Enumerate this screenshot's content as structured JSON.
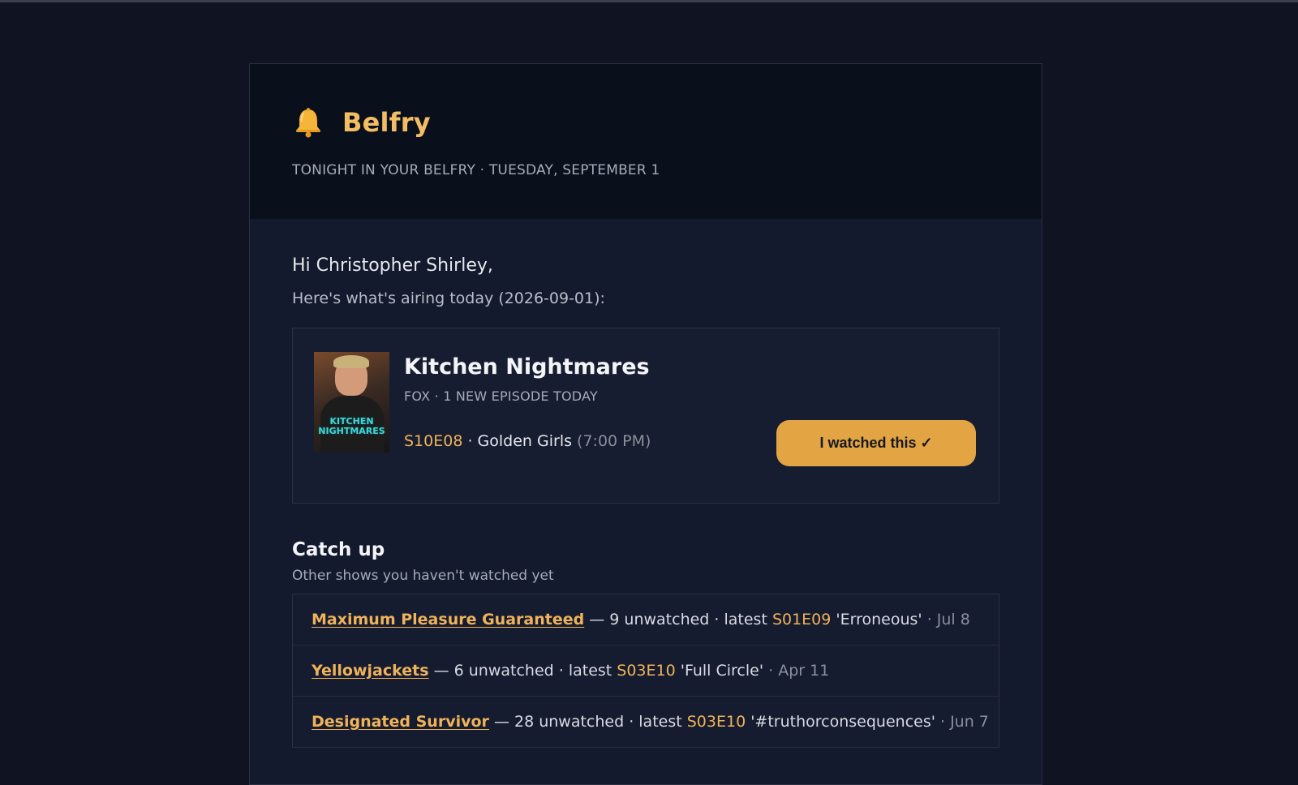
{
  "header": {
    "brand_name": "Belfry",
    "bell_icon": "bell-icon",
    "tagline": "TONIGHT IN YOUR BELFRY · TUESDAY, SEPTEMBER 1"
  },
  "intro": {
    "greeting": "Hi Christopher Shirley,",
    "airing_text": "Here's what's airing today (2026-09-01):"
  },
  "show": {
    "title": "Kitchen Nightmares",
    "meta": "FOX · 1 NEW EPISODE TODAY",
    "poster_text": "KITCHEN NIGHTMARES",
    "episode_code": "S10E08",
    "episode_sep": " · ",
    "episode_title": "Golden Girls",
    "episode_time": "(7:00 PM)",
    "watched_button": "I watched this ✓"
  },
  "catch_up": {
    "title": "Catch up",
    "subtitle": "Other shows you haven't watched yet",
    "items": [
      {
        "show": "Maximum Pleasure Guaranteed",
        "count_text": " — 9 unwatched · latest ",
        "code": "S01E09",
        "episode": " 'Erroneous'",
        "date_sep": " · ",
        "date": "Jul 8"
      },
      {
        "show": "Yellowjackets",
        "count_text": " — 6 unwatched · latest ",
        "code": "S03E10",
        "episode": " 'Full Circle'",
        "date_sep": " · ",
        "date": "Apr 11"
      },
      {
        "show": "Designated Survivor",
        "count_text": " — 28 unwatched · latest ",
        "code": "S03E10",
        "episode": " '#truthorconsequences'",
        "date_sep": " · ",
        "date": "Jun 7"
      }
    ]
  },
  "colors": {
    "accent": "#f0b25a",
    "button": "#e3a444",
    "background": "#0f1322"
  }
}
